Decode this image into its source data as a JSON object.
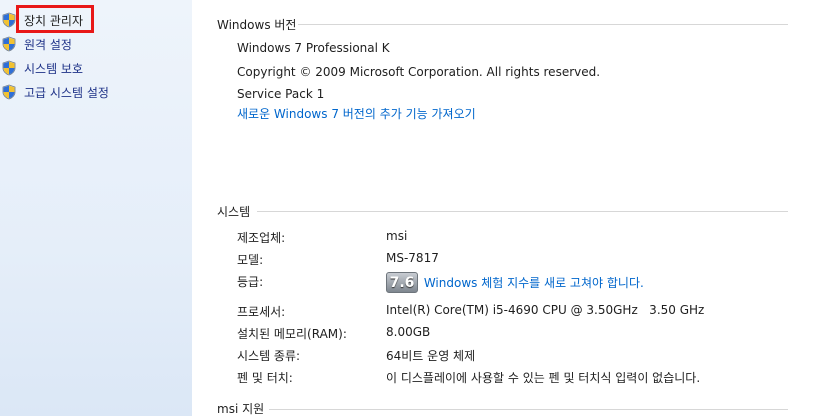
{
  "sidebar": {
    "items": [
      {
        "label": "장치 관리자"
      },
      {
        "label": "원격 설정"
      },
      {
        "label": "시스템 보호"
      },
      {
        "label": "고급 시스템 설정"
      }
    ]
  },
  "colors": {
    "highlight": "#e81818",
    "link": "#0066cc",
    "sidebar_bg": "#e5eef9"
  },
  "windows_edition": {
    "header": "Windows 버전",
    "edition": "Windows 7 Professional K",
    "copyright": "Copyright © 2009 Microsoft Corporation. All rights reserved.",
    "service_pack": "Service Pack 1",
    "upgrade_link": "새로운 Windows 7 버전의 추가 기능 가져오기"
  },
  "system": {
    "header": "시스템",
    "rows": [
      {
        "label": "제조업체:",
        "value": "msi"
      },
      {
        "label": "모델:",
        "value": "MS-7817"
      },
      {
        "label": "등급:",
        "score": "7.6",
        "value": "Windows 체험 지수를 새로 고쳐야 합니다."
      },
      {
        "label": "프로세서:",
        "value": "Intel(R) Core(TM) i5-4690 CPU @ 3.50GHz   3.50 GHz"
      },
      {
        "label": "설치된 메모리(RAM):",
        "value": "8.00GB"
      },
      {
        "label": "시스템 종류:",
        "value": "64비트 운영 체제"
      },
      {
        "label": "펜 및 터치:",
        "value": "이 디스플레이에 사용할 수 있는 펜 및 터치식 입력이 없습니다."
      }
    ]
  },
  "support": {
    "header": "msi 지원"
  }
}
